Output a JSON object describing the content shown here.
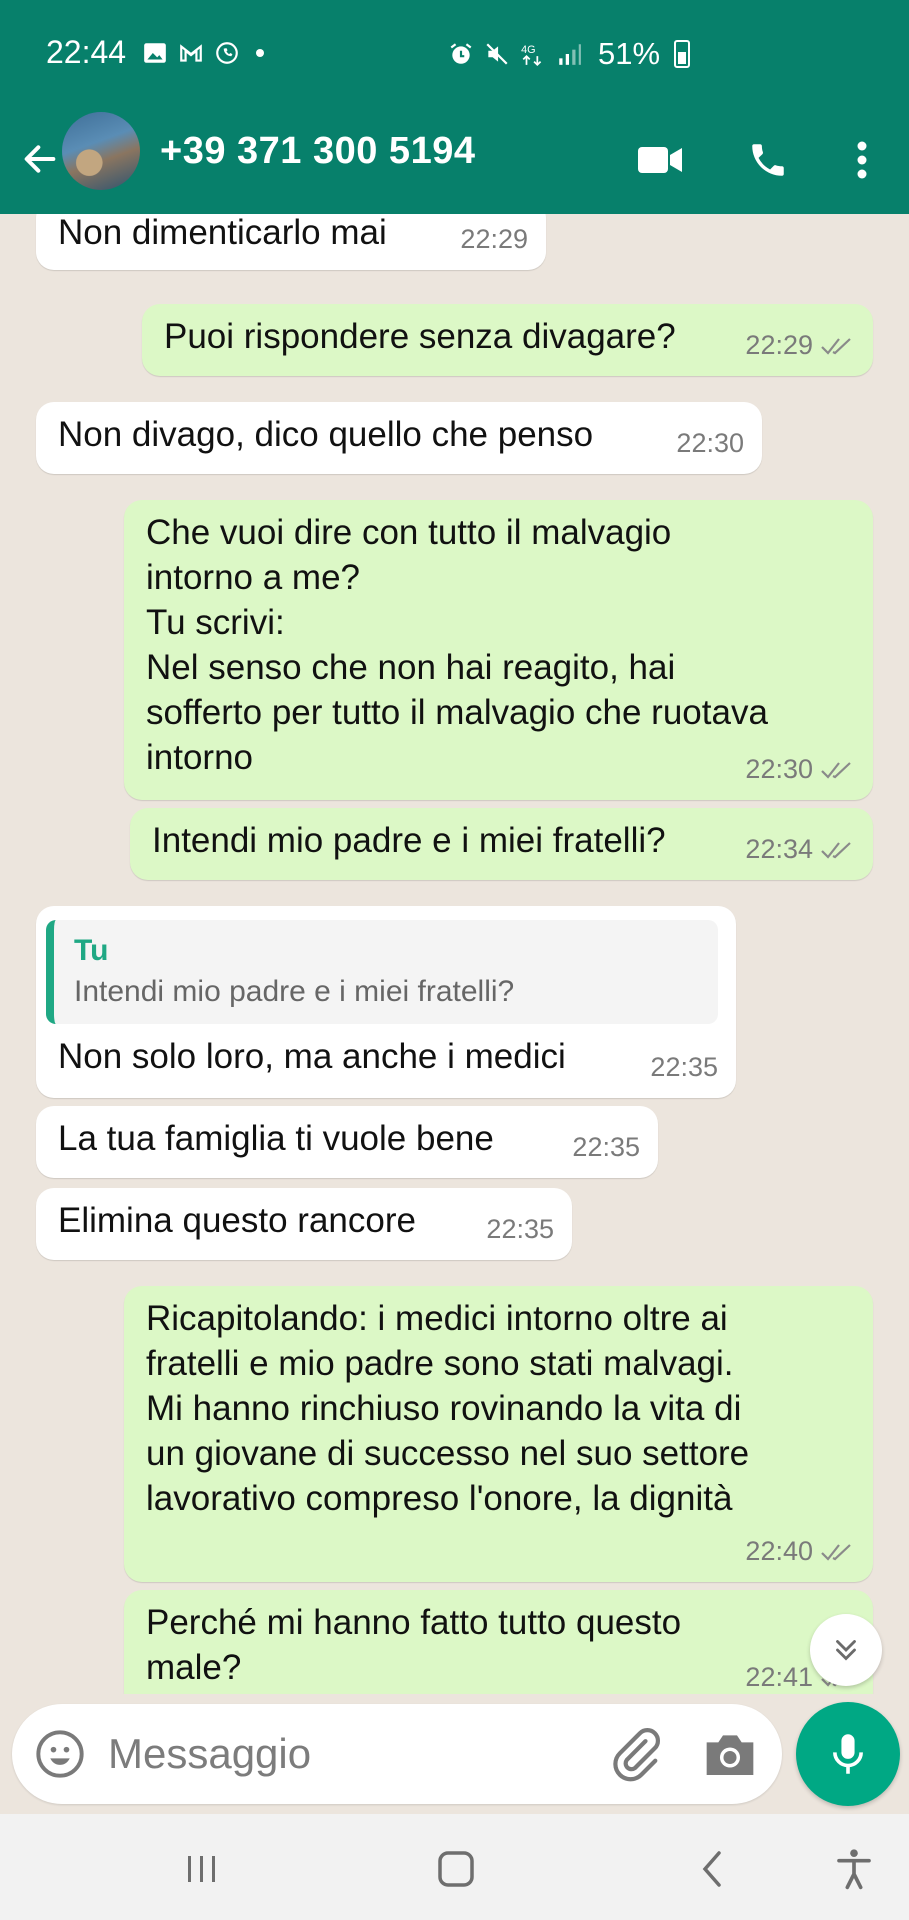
{
  "status_bar": {
    "time": "22:44",
    "battery": "51%",
    "left_icons": [
      "image-icon",
      "gmail-icon",
      "whatsapp-icon",
      "dot-icon"
    ],
    "right_icons": [
      "alarm-icon",
      "mute-icon",
      "4g-icon",
      "signal-icon",
      "battery-icon"
    ]
  },
  "header": {
    "contact": "+39 371 300 5194",
    "icons": [
      "back-arrow-icon",
      "avatar",
      "video-call-icon",
      "phone-icon",
      "more-vertical-icon"
    ]
  },
  "messages": [
    {
      "dir": "in",
      "text": "Non dimenticarlo mai",
      "time": "22:29"
    },
    {
      "dir": "out",
      "text": "Puoi rispondere senza divagare?",
      "time": "22:29"
    },
    {
      "dir": "in",
      "text": "Non divago, dico quello che penso",
      "time": "22:30"
    },
    {
      "dir": "out",
      "lines": [
        "Che vuoi dire con tutto il malvagio",
        "intorno a me?",
        "Tu scrivi:",
        "Nel senso che non hai reagito, hai",
        "sofferto per tutto il malvagio che ruotava",
        "intorno"
      ],
      "time": "22:30"
    },
    {
      "dir": "out",
      "text": "Intendi mio padre e i miei fratelli?",
      "time": "22:34"
    },
    {
      "dir": "in",
      "reply_author": "Tu",
      "reply_text": "Intendi mio padre e i miei fratelli?",
      "text": "Non solo loro, ma anche i medici",
      "time": "22:35"
    },
    {
      "dir": "in",
      "text": "La tua famiglia ti vuole bene",
      "time": "22:35"
    },
    {
      "dir": "in",
      "text": "Elimina questo rancore",
      "time": "22:35"
    },
    {
      "dir": "out",
      "lines": [
        "Ricapitolando: i medici intorno oltre ai",
        "fratelli e mio padre sono stati malvagi.",
        "Mi hanno rinchiuso rovinando la vita di",
        "un giovane di successo nel suo settore",
        "lavorativo compreso l'onore, la dignità"
      ],
      "time": "22:40"
    },
    {
      "dir": "out",
      "lines": [
        "Perché mi hanno fatto tutto questo",
        "male?"
      ],
      "time": "22:41"
    }
  ],
  "input": {
    "placeholder": "Messaggio"
  },
  "colors": {
    "header": "#07806b",
    "outgoing": "#dcf8c6",
    "incoming": "#ffffff",
    "accent": "#00a884",
    "chat_bg": "#ece5dd"
  }
}
